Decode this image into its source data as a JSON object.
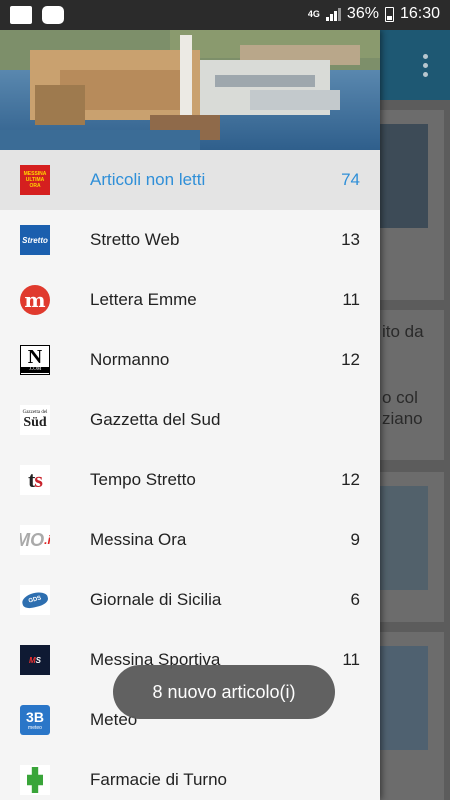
{
  "status_bar": {
    "network": "4G",
    "battery": "36%",
    "time": "16:30"
  },
  "colors": {
    "accent": "#2f8fd8",
    "toolbar": "#1e5873",
    "drawer_bg": "#f5f5f5",
    "toast_bg": "#5b5b5b"
  },
  "background": {
    "fragments": [
      "ito da",
      "o col",
      "ziano"
    ]
  },
  "drawer": {
    "items": [
      {
        "label": "Articoli non letti",
        "count": "74",
        "icon": "unread-articles-icon",
        "icon_text": "MESSINA ULTIMA ORA"
      },
      {
        "label": "Stretto Web",
        "count": "13",
        "icon": "stretto-web-icon",
        "icon_text": "Stretto Web"
      },
      {
        "label": "Lettera Emme",
        "count": "11",
        "icon": "lettera-emme-icon",
        "icon_text": "m"
      },
      {
        "label": "Normanno",
        "count": "12",
        "icon": "normanno-icon",
        "icon_text": "N"
      },
      {
        "label": "Gazzetta del Sud",
        "count": "",
        "icon": "gazzetta-del-sud-icon",
        "icon_text": "Süd"
      },
      {
        "label": "Tempo Stretto",
        "count": "12",
        "icon": "tempo-stretto-icon",
        "icon_text": "ts"
      },
      {
        "label": "Messina Ora",
        "count": "9",
        "icon": "messina-ora-icon",
        "icon_text": "MO"
      },
      {
        "label": "Giornale di Sicilia",
        "count": "6",
        "icon": "giornale-di-sicilia-icon",
        "icon_text": "GDS"
      },
      {
        "label": "Messina Sportiva",
        "count": "11",
        "icon": "messina-sportiva-icon",
        "icon_text": "MS"
      },
      {
        "label": "Meteo",
        "count": "",
        "icon": "meteo-icon",
        "icon_text": "3B"
      },
      {
        "label": "Farmacie di Turno",
        "count": "",
        "icon": "farmacie-icon",
        "icon_text": ""
      }
    ]
  },
  "toast": {
    "message": "8 nuovo articolo(i)"
  }
}
